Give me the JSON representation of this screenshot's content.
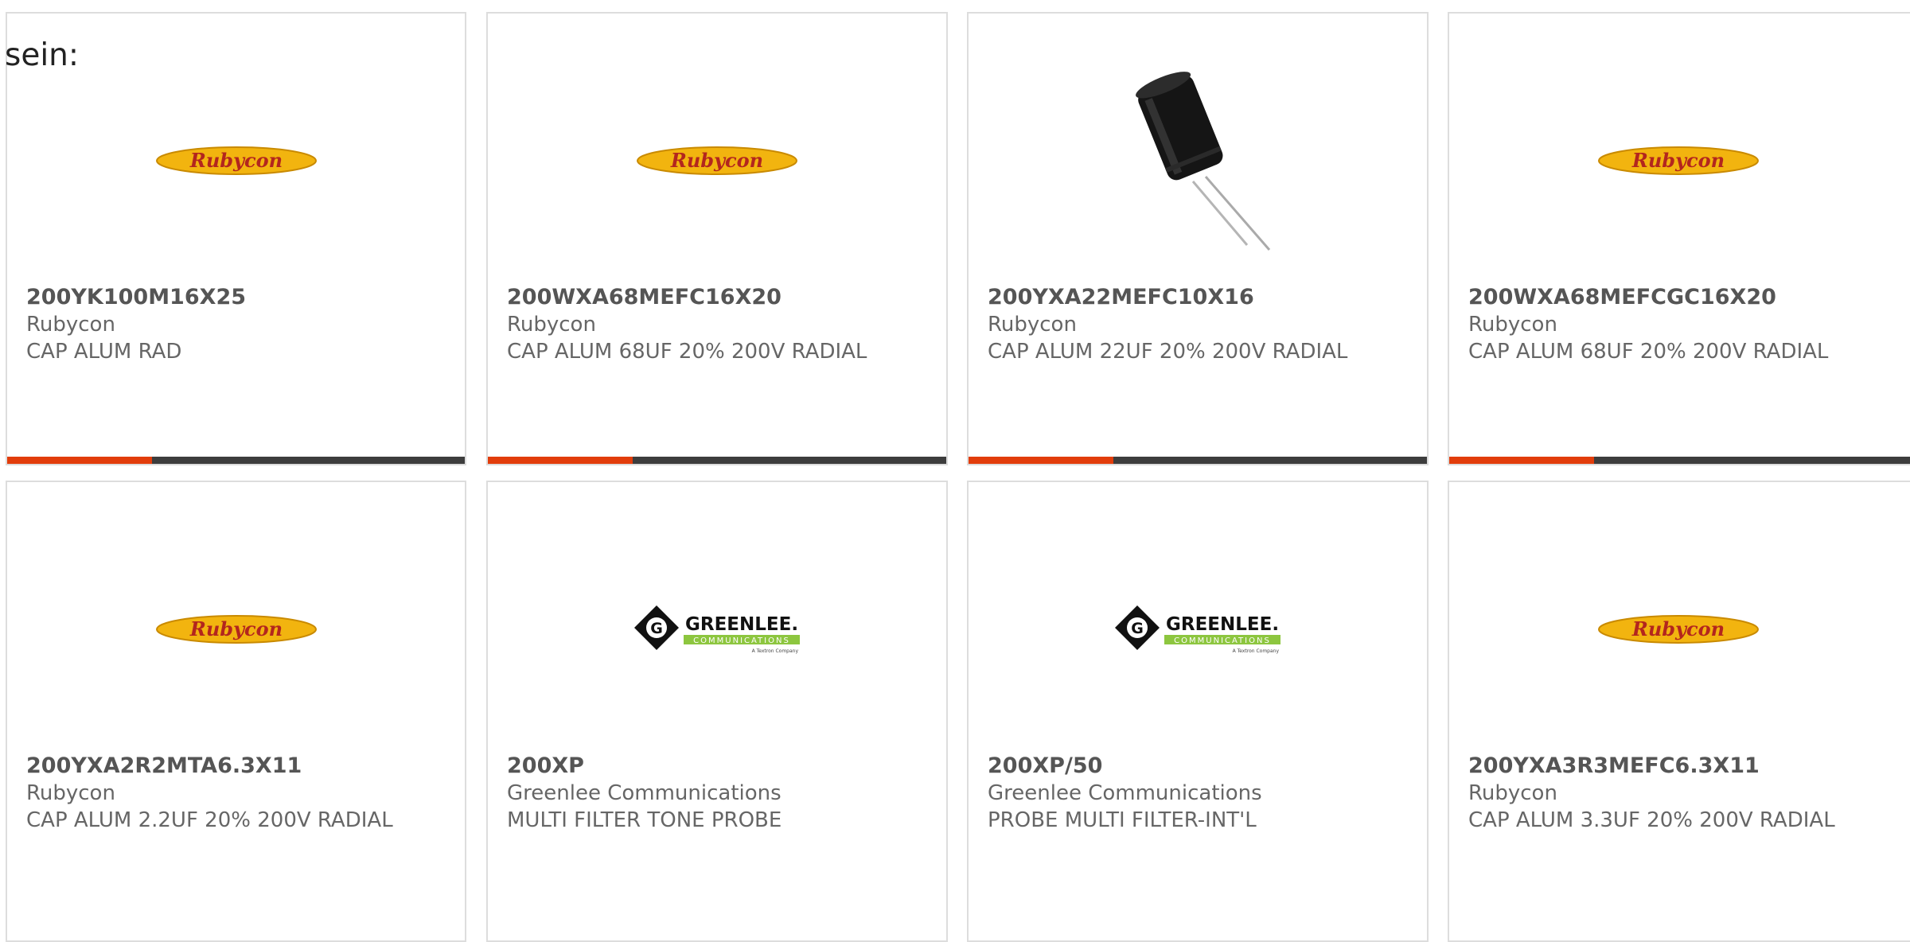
{
  "intro_text": "sein:",
  "colors": {
    "accent": "#e23d0b",
    "bar": "#3d3d3d",
    "border": "#dddddd",
    "rubycon_yellow": "#f2b40f",
    "greenlee_green": "#8dc63f"
  },
  "products": [
    {
      "part_number": "200YK100M16X25",
      "manufacturer": "Rubycon",
      "description": "CAP ALUM RAD",
      "image": "rubycon-logo",
      "logo_text": "Rubycon"
    },
    {
      "part_number": "200WXA68MEFC16X20",
      "manufacturer": "Rubycon",
      "description": "CAP ALUM 68UF 20% 200V RADIAL",
      "image": "rubycon-logo",
      "logo_text": "Rubycon"
    },
    {
      "part_number": "200YXA22MEFC10X16",
      "manufacturer": "Rubycon",
      "description": "CAP ALUM 22UF 20% 200V RADIAL",
      "image": "capacitor-photo"
    },
    {
      "part_number": "200WXA68MEFCGC16X20",
      "manufacturer": "Rubycon",
      "description": "CAP ALUM 68UF 20% 200V RADIAL",
      "image": "rubycon-logo",
      "logo_text": "Rubycon"
    },
    {
      "part_number": "200YXA2R2MTA6.3X11",
      "manufacturer": "Rubycon",
      "description": "CAP ALUM 2.2UF 20% 200V RADIAL",
      "image": "rubycon-logo",
      "logo_text": "Rubycon"
    },
    {
      "part_number": "200XP",
      "manufacturer": "Greenlee Communications",
      "description": "MULTI FILTER TONE PROBE",
      "image": "greenlee-logo",
      "logo_text": "GREENLEE.",
      "logo_subtext": "COMMUNICATIONS",
      "logo_tagline": "A Textron Company"
    },
    {
      "part_number": "200XP/50",
      "manufacturer": "Greenlee Communications",
      "description": "PROBE MULTI FILTER-INT'L",
      "image": "greenlee-logo",
      "logo_text": "GREENLEE.",
      "logo_subtext": "COMMUNICATIONS",
      "logo_tagline": "A Textron Company"
    },
    {
      "part_number": "200YXA3R3MEFC6.3X11",
      "manufacturer": "Rubycon",
      "description": "CAP ALUM 3.3UF 20% 200V RADIAL",
      "image": "rubycon-logo",
      "logo_text": "Rubycon"
    }
  ]
}
